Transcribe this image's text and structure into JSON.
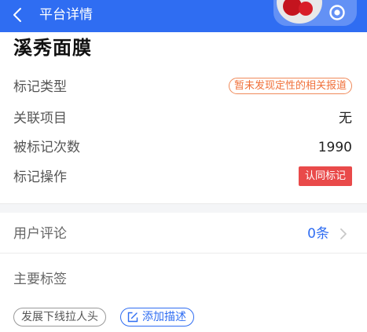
{
  "header": {
    "title": "平台详情",
    "back_icon": "chevron-left-icon",
    "action_icon": "target-icon",
    "bg_color": "#2f6df2"
  },
  "main": {
    "title": "溪秀面膜"
  },
  "details": {
    "mark_type": {
      "label": "标记类型",
      "value": "暂未发现定性的相关报道"
    },
    "related_project": {
      "label": "关联项目",
      "value": "无"
    },
    "mark_count": {
      "label": "被标记次数",
      "value": "1990"
    },
    "mark_action": {
      "label": "标记操作",
      "button": "认同标记"
    }
  },
  "comments": {
    "label": "用户评论",
    "count": "0条"
  },
  "tags": {
    "title": "主要标签",
    "items": [
      "发展下线拉人头"
    ],
    "add_label": "添加描述"
  },
  "colors": {
    "accent": "#2f6df2",
    "danger": "#e94a4a",
    "warning": "#f0703a"
  }
}
